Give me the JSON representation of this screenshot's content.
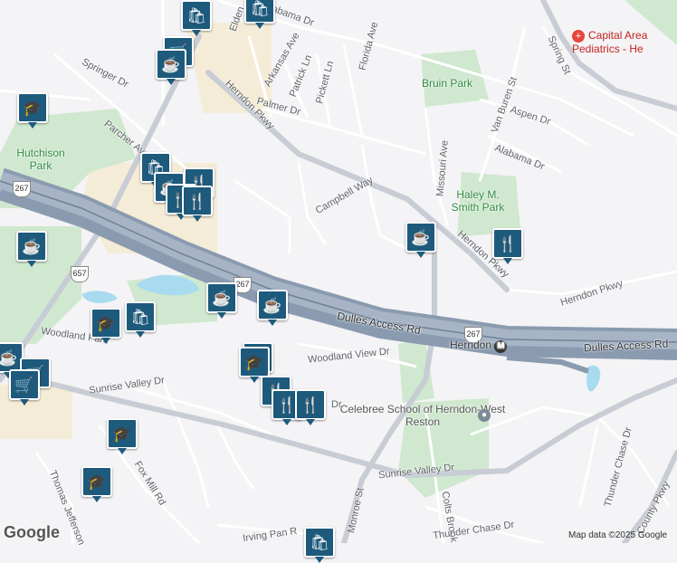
{
  "map": {
    "streets": [
      "Alabama Dr",
      "Arkansas Ave",
      "Patrick Ln",
      "Pickett Ln",
      "Florida Ave",
      "Palmer Dr",
      "Herndon Pkwy",
      "Springer Dr",
      "Parcher Ave",
      "Campbell Way",
      "Missouri Ave",
      "Van Buren St",
      "Aspen Dr",
      "Alabama Dr",
      "Spring St",
      "Herndon Pkwy",
      "Herndon Pkwy",
      "Dulles Access Rd",
      "Dulles Access Rd",
      "Woodland Park",
      "Woodland View Dr",
      "Sunrise Valley Dr",
      "Sunrise Valley Dr",
      "Fox Mill Rd",
      "Thomas Jefferson",
      "Monroe St",
      "Colts Brook",
      "Thunder Chase Dr",
      "Thunder Chase Dr",
      "County Pkwy",
      "Irving Pan R",
      "Elden",
      "Dr"
    ],
    "parks": [
      "Bruin Park",
      "Hutchison Park",
      "Haley M. Smith Park"
    ],
    "places": [
      "Capital Area Pediatrics - He",
      "Celebree School of Herndon-West Reston"
    ],
    "shields": [
      "267",
      "657",
      "267",
      "267"
    ],
    "metro": {
      "name": "Herndon",
      "icon": "M"
    },
    "footer": {
      "logo": "Google",
      "attribution": "Map data ©2025 Google"
    },
    "markers": [
      {
        "icon": "shopping-bag-icon",
        "glyph": "🛍"
      },
      {
        "icon": "shopping-bag-icon",
        "glyph": "🛍"
      },
      {
        "icon": "shopping-cart-icon",
        "glyph": "🛒"
      },
      {
        "icon": "cafe-icon",
        "glyph": "☕"
      },
      {
        "icon": "school-icon",
        "glyph": "🎓"
      },
      {
        "icon": "shopping-bag-icon",
        "glyph": "🛍"
      },
      {
        "icon": "restaurant-icon",
        "glyph": "🍴"
      },
      {
        "icon": "cafe-icon",
        "glyph": "☕"
      },
      {
        "icon": "restaurant-icon",
        "glyph": "🍴"
      },
      {
        "icon": "restaurant-icon",
        "glyph": "🍴"
      },
      {
        "icon": "cafe-icon",
        "glyph": "☕"
      },
      {
        "icon": "restaurant-icon",
        "glyph": "🍴"
      },
      {
        "icon": "cafe-icon",
        "glyph": "☕"
      },
      {
        "icon": "school-icon",
        "glyph": "🎓"
      },
      {
        "icon": "shopping-bag-icon",
        "glyph": "🛍"
      },
      {
        "icon": "cafe-icon",
        "glyph": "☕"
      },
      {
        "icon": "cafe-icon",
        "glyph": "☕"
      },
      {
        "icon": "cafe-icon",
        "glyph": "☕"
      },
      {
        "icon": "shopping-cart-icon",
        "glyph": "🛒"
      },
      {
        "icon": "shopping-cart-icon",
        "glyph": "🛒"
      },
      {
        "icon": "school-icon",
        "glyph": "🎓"
      },
      {
        "icon": "school-icon",
        "glyph": "🎓"
      },
      {
        "icon": "restaurant-icon",
        "glyph": "🍴"
      },
      {
        "icon": "restaurant-icon",
        "glyph": "🍴"
      },
      {
        "icon": "restaurant-icon",
        "glyph": "🍴"
      },
      {
        "icon": "school-icon",
        "glyph": "🎓"
      },
      {
        "icon": "school-icon",
        "glyph": "🎓"
      },
      {
        "icon": "shopping-bag-icon",
        "glyph": "🛍"
      }
    ],
    "colors": {
      "land": "#f4f3f5",
      "park": "#cfe8cf",
      "commercial": "#f5ecd8",
      "highway": "#8a9bb0",
      "marker": "#1e5a7c",
      "water": "#a8dbf0"
    }
  }
}
